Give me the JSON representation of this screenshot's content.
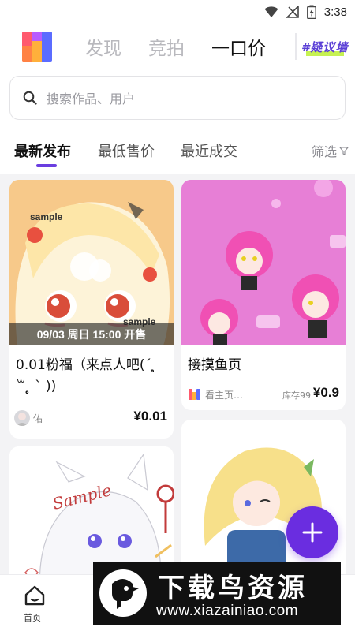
{
  "status_bar": {
    "time": "3:38"
  },
  "header": {
    "tabs": [
      {
        "label": "发现"
      },
      {
        "label": "竞拍"
      },
      {
        "label": "一口价"
      }
    ],
    "active_tab": "一口价",
    "wall_badge": "#疑议墙"
  },
  "search": {
    "placeholder": "搜索作品、用户"
  },
  "sort": {
    "tabs": [
      {
        "label": "最新发布"
      },
      {
        "label": "最低售价"
      },
      {
        "label": "最近成交"
      }
    ],
    "active_tab": "最新发布",
    "filter_label": "筛选"
  },
  "feed": {
    "cards": [
      {
        "title": "0.01粉福（来点人吧(´ ̥̥̥ ꒳ ̥̥̥ ` ))",
        "time_overlay": "09/03 周日 15:00 开售",
        "seller": "佑",
        "price": "¥0.01",
        "image_watermark_top": "sample",
        "image_watermark_bottom": "sample"
      },
      {
        "title": "接摸鱼页",
        "seller": "看主页…",
        "stock": "库存99",
        "price": "¥0.9"
      },
      {
        "image_watermark": "Sample"
      },
      {}
    ]
  },
  "fab": {
    "icon": "plus-icon"
  },
  "bottom_nav": {
    "items": [
      {
        "label": "首页",
        "icon": "home-icon"
      }
    ]
  },
  "watermark": {
    "title": "下载鸟资源",
    "url": "www.xiazainiao.com"
  },
  "colors": {
    "accent": "#6a2de0",
    "wall_badge_text": "#5a3fd6",
    "wall_badge_highlight": "#c6f252",
    "card1_bg": "#f7c98a",
    "card2_bg": "#e77fd6"
  }
}
